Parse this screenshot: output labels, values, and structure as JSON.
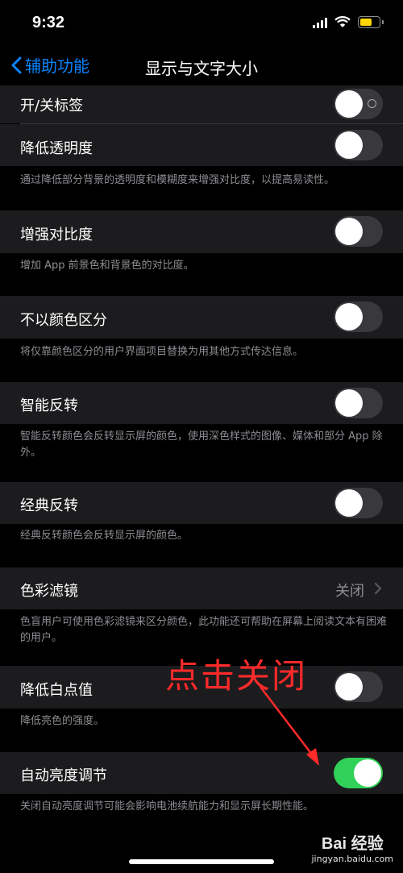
{
  "status": {
    "time": "9:32"
  },
  "nav": {
    "back_label": "辅助功能",
    "title": "显示与文字大小"
  },
  "rows": {
    "onoff_labels": {
      "label": "开/关标签",
      "on": false
    },
    "reduce_transparency": {
      "label": "降低透明度",
      "on": false,
      "footer": "通过降低部分背景的透明度和模糊度来增强对比度，以提高易读性。"
    },
    "increase_contrast": {
      "label": "增强对比度",
      "on": false,
      "footer": "增加 App 前景色和背景色的对比度。"
    },
    "differentiate_without_color": {
      "label": "不以颜色区分",
      "on": false,
      "footer": "将仅靠颜色区分的用户界面项目替换为用其他方式传达信息。"
    },
    "smart_invert": {
      "label": "智能反转",
      "on": false,
      "footer": "智能反转颜色会反转显示屏的颜色，使用深色样式的图像、媒体和部分 App 除外。"
    },
    "classic_invert": {
      "label": "经典反转",
      "on": false,
      "footer": "经典反转颜色会反转显示屏的颜色。"
    },
    "color_filters": {
      "label": "色彩滤镜",
      "value": "关闭",
      "footer": "色盲用户可使用色彩滤镜来区分颜色，此功能还可帮助在屏幕上阅读文本有困难的用户。"
    },
    "reduce_white_point": {
      "label": "降低白点值",
      "on": false,
      "footer": "降低亮色的强度。"
    },
    "auto_brightness": {
      "label": "自动亮度调节",
      "on": true,
      "footer": "关闭自动亮度调节可能会影响电池续航能力和显示屏长期性能。"
    }
  },
  "annotation": {
    "text": "点击关闭",
    "color": "#ff2a2a"
  },
  "watermark": {
    "brand": "Bai 经验",
    "url": "jingyan.baidu.com"
  },
  "colors": {
    "accent": "#0a84ff",
    "toggle_on": "#30d158",
    "battery": "#ffd60a"
  }
}
